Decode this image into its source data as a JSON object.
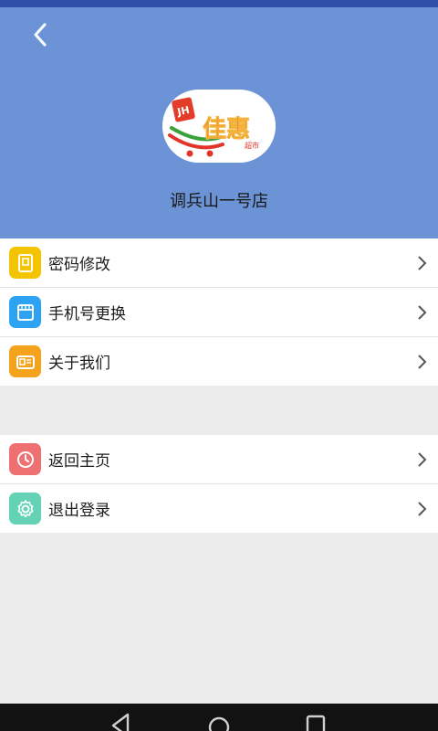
{
  "header": {
    "store_name": "调兵山一号店",
    "background_color": "#6b93d6",
    "logo": {
      "text_main": "佳惠",
      "text_badge": "JH",
      "text_sub": "超市"
    }
  },
  "menu_groups": [
    {
      "items": [
        {
          "label": "密码修改",
          "icon": "lock-document-icon",
          "color": "#f5c400"
        },
        {
          "label": "手机号更换",
          "icon": "phone-card-icon",
          "color": "#2fa3f3"
        },
        {
          "label": "关于我们",
          "icon": "id-card-icon",
          "color": "#f5a21c"
        }
      ]
    },
    {
      "items": [
        {
          "label": "返回主页",
          "icon": "clock-icon",
          "color": "#ef7070"
        },
        {
          "label": "退出登录",
          "icon": "gear-icon",
          "color": "#63d2b5"
        }
      ]
    }
  ],
  "system_nav": {
    "buttons": [
      "back-triangle-icon",
      "home-circle-icon",
      "recents-square-icon"
    ]
  }
}
